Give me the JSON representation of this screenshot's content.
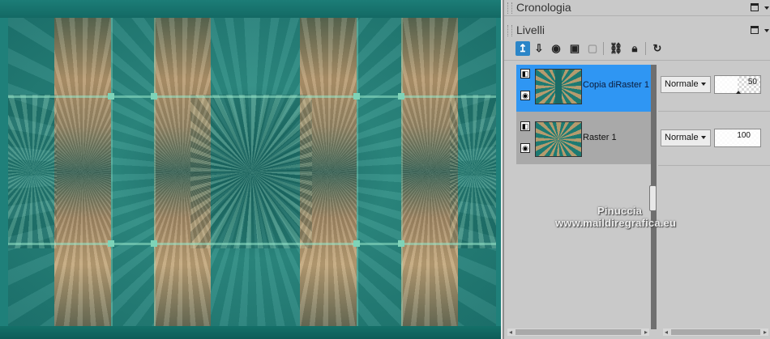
{
  "panels": {
    "history": {
      "title": "Cronologia"
    },
    "layers": {
      "title": "Livelli"
    }
  },
  "toolbar": {
    "buttons": [
      {
        "icon": "new-layer-icon"
      },
      {
        "icon": "merge-down-icon"
      },
      {
        "icon": "visibility-icon"
      },
      {
        "icon": "layer-mask-icon"
      },
      {
        "icon": "delete-mask-icon"
      },
      {
        "icon": "link-icon"
      },
      {
        "icon": "lock-icon"
      },
      {
        "icon": "refresh-icon"
      }
    ]
  },
  "layers": [
    {
      "name": "Copia diRaster 1",
      "mode": "Normale",
      "opacity": 50,
      "selected": true,
      "thumb_icon": "layer-thumbnail-icon"
    },
    {
      "name": "Raster 1",
      "mode": "Normale",
      "opacity": 100,
      "selected": false,
      "thumb_icon": "layer-thumbnail-icon"
    }
  ],
  "watermark": {
    "line1": "Pinuccia",
    "line2": "www.maildiregrafica.eu"
  },
  "colors": {
    "selection": "#2f96f3",
    "artwork_teal": "#1f807a",
    "panel_bg": "#c9c9c9"
  }
}
